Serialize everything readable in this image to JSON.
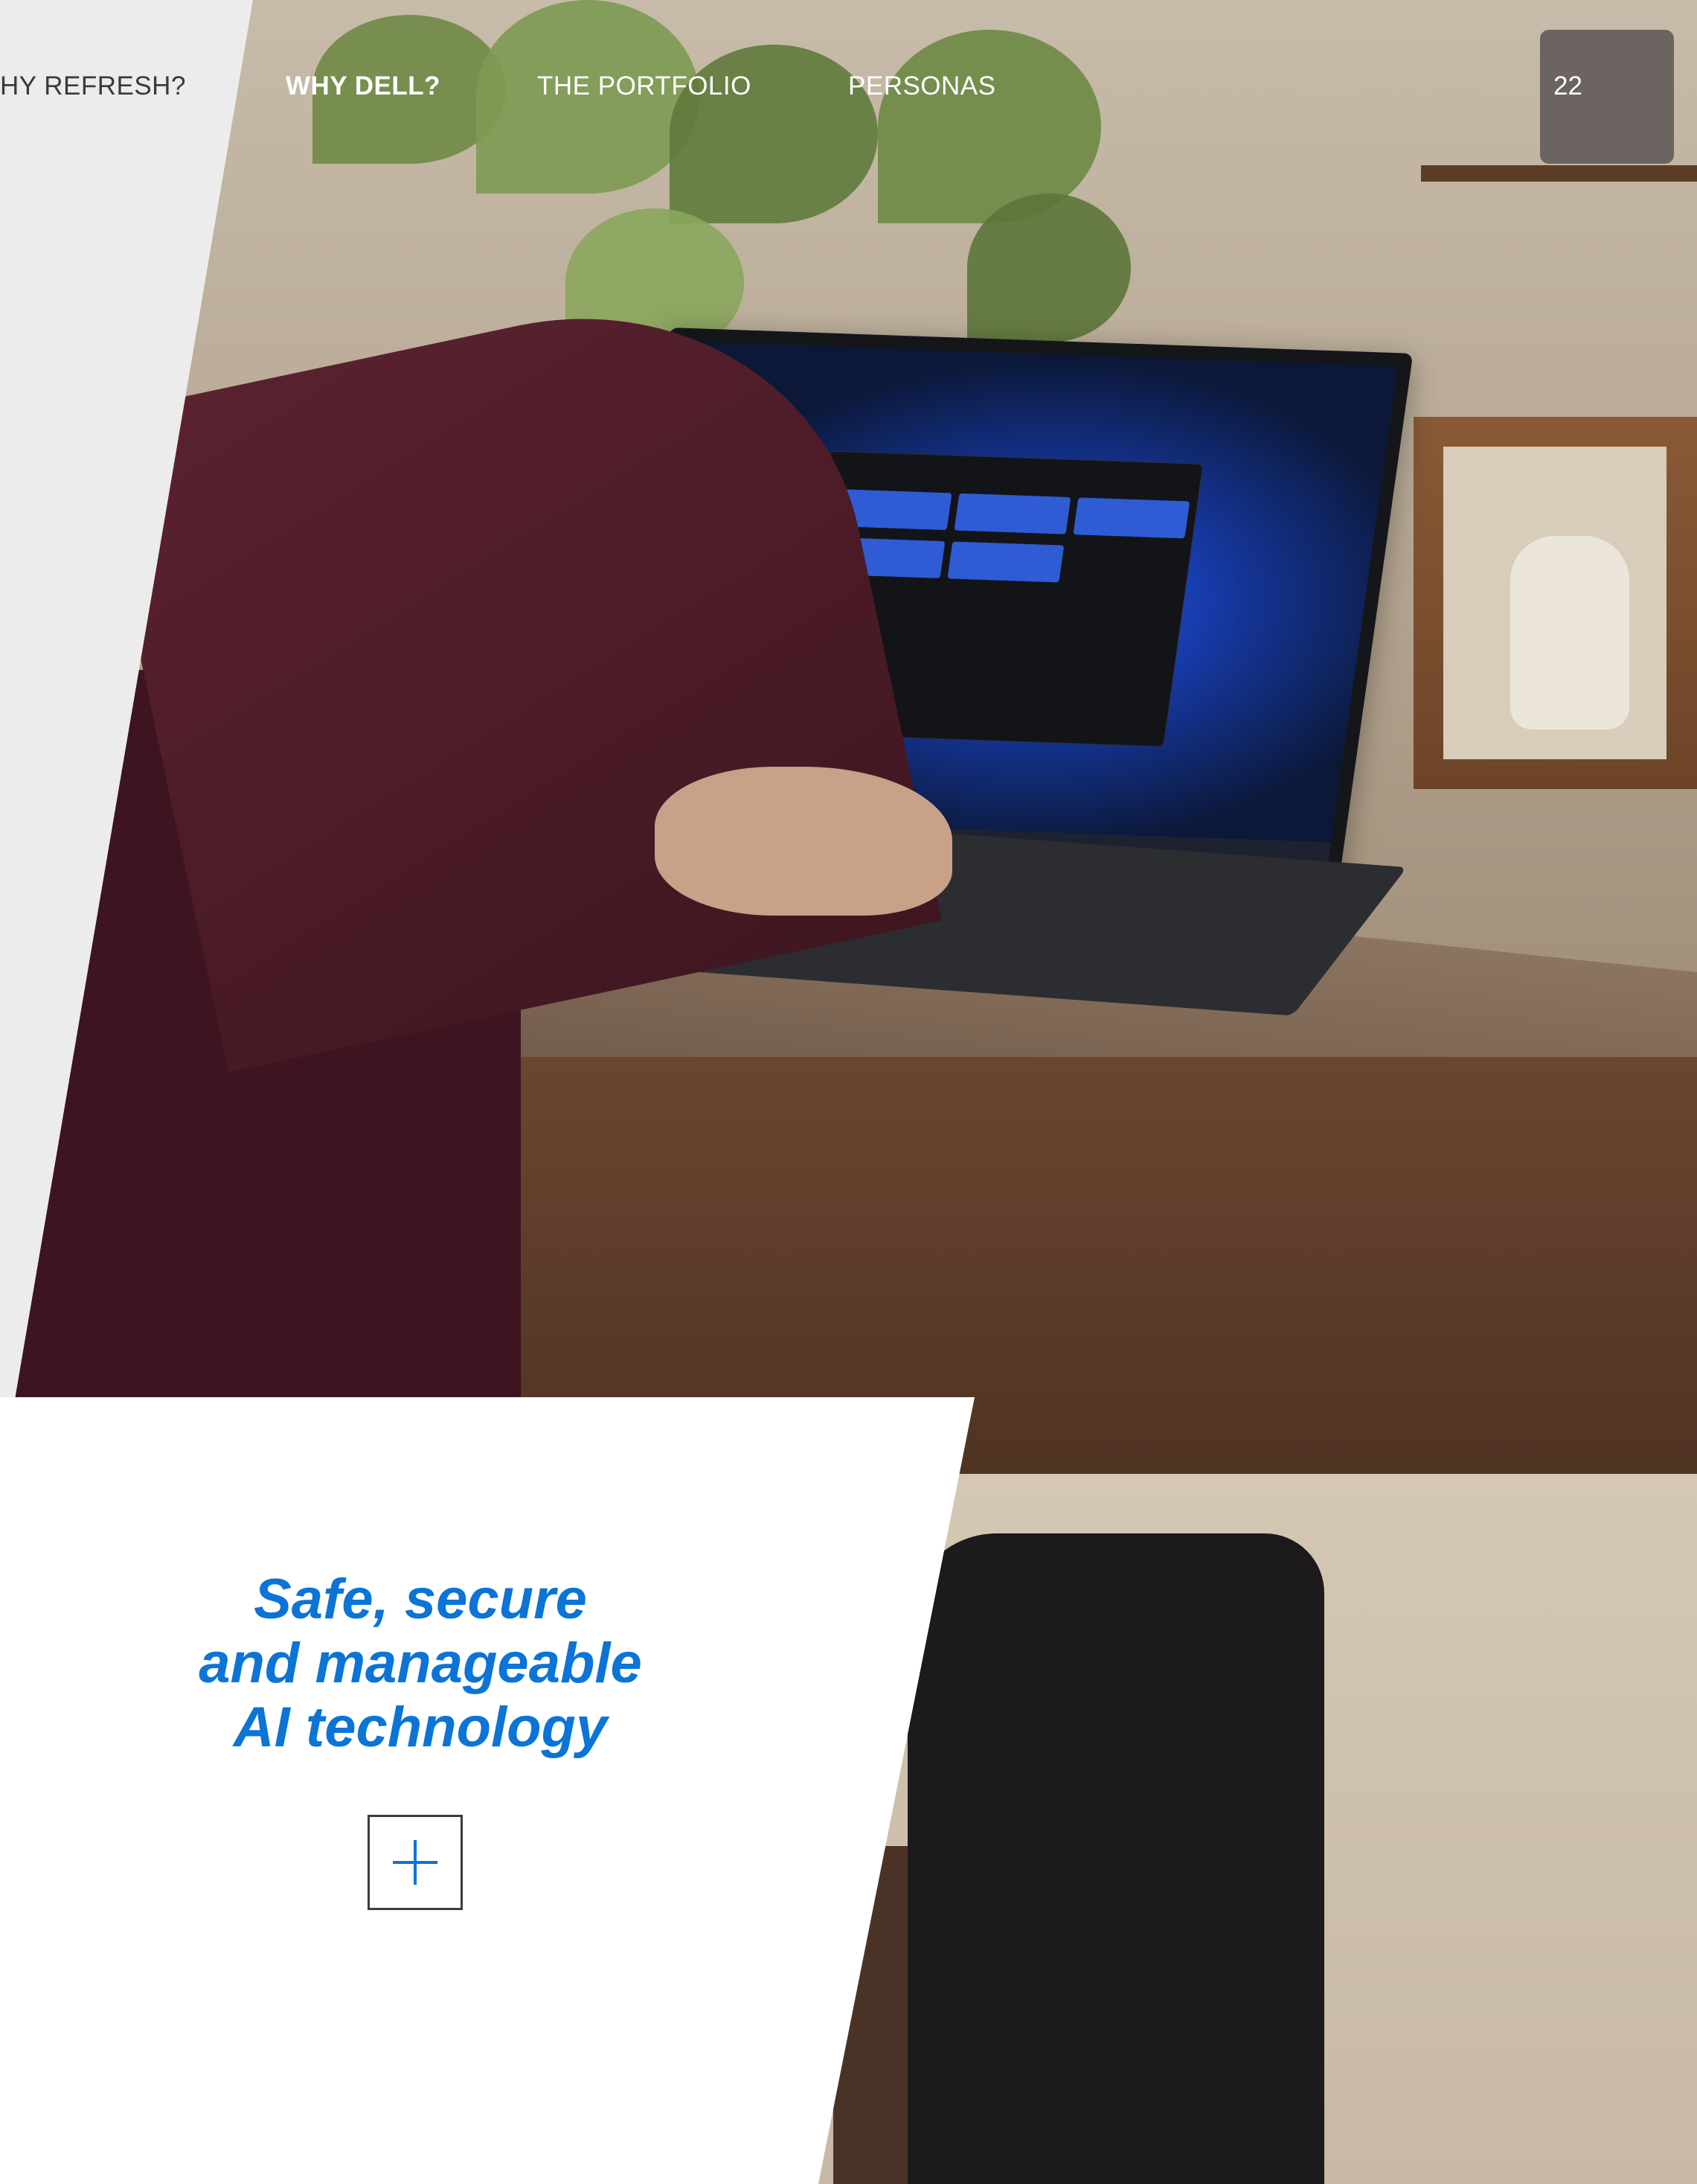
{
  "nav": {
    "items": [
      {
        "label": "HY REFRESH?",
        "active": false
      },
      {
        "label": "WHY DELL?",
        "active": true
      },
      {
        "label": "THE PORTFOLIO",
        "active": false
      },
      {
        "label": "PERSONAS",
        "active": false
      }
    ],
    "page_number": "22"
  },
  "content": {
    "headline_lines": [
      "Safe, secure",
      "and manageable",
      "AI technology"
    ],
    "expand_icon": "plus-icon"
  },
  "colors": {
    "accent_blue": "#0b74d6",
    "panel_white": "#ffffff",
    "panel_light_gray": "#ececec",
    "nav_dark_text": "#3a3a3a",
    "nav_light_text": "#ffffff"
  }
}
